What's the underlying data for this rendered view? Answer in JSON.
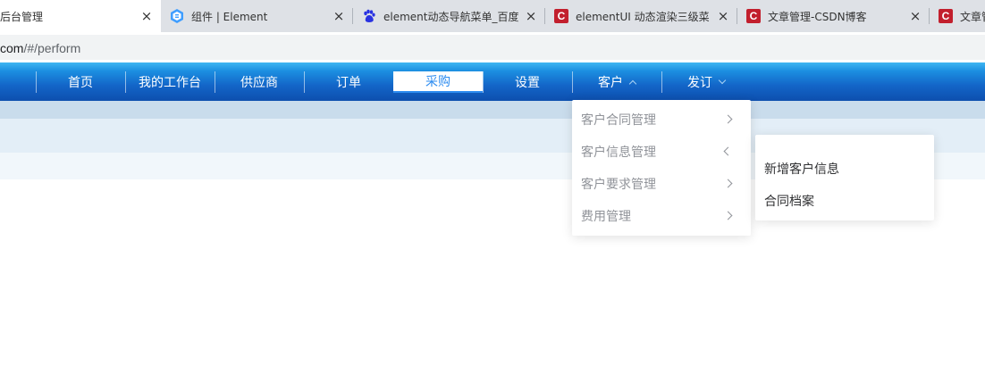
{
  "browser": {
    "tabs": [
      {
        "title": "后台管理",
        "icon": "none",
        "close": "×",
        "active": true
      },
      {
        "title": "组件 | Element",
        "icon": "element-logo-icon",
        "close": "×",
        "active": false
      },
      {
        "title": "element动态导航菜单_百度",
        "icon": "baidu-paw-icon",
        "close": "×",
        "active": false
      },
      {
        "title": "elementUI 动态渲染三级菜",
        "icon": "csdn-c-icon",
        "close": "×",
        "active": false
      },
      {
        "title": "文章管理-CSDN博客",
        "icon": "csdn-c-icon",
        "close": "×",
        "active": false
      },
      {
        "title": "文章管",
        "icon": "csdn-c-icon",
        "close": "",
        "active": false
      }
    ],
    "address": {
      "host": "com",
      "path": "/#/perform"
    }
  },
  "nav": {
    "items": [
      {
        "label": "首页"
      },
      {
        "label": "我的工作台"
      },
      {
        "label": "供应商"
      },
      {
        "label": "订单"
      },
      {
        "label": "采购",
        "active": true
      },
      {
        "label": "设置"
      },
      {
        "label": "客户",
        "caret": "up"
      },
      {
        "label": "发订",
        "caret": "down"
      }
    ]
  },
  "submenu": {
    "items": [
      {
        "label": "客户合同管理",
        "chevron": "right"
      },
      {
        "label": "客户信息管理",
        "chevron": "left"
      },
      {
        "label": "客户要求管理",
        "chevron": "right"
      },
      {
        "label": "费用管理",
        "chevron": "right"
      }
    ]
  },
  "flyout": {
    "items": [
      {
        "label": "新增客户信息"
      },
      {
        "label": "合同档案"
      }
    ]
  },
  "colors": {
    "nav_top": "#3fb6f2",
    "nav_bottom": "#0d4fae",
    "active_text": "#2d8cf0",
    "csdn_red": "#c21f2d"
  }
}
